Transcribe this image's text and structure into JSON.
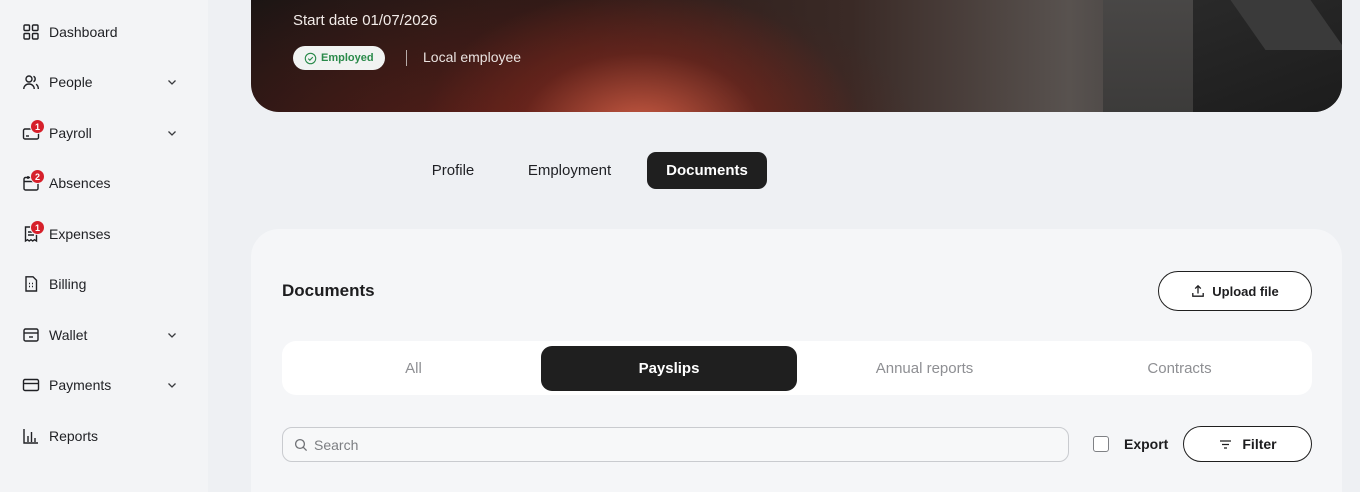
{
  "sidebar": {
    "items": [
      {
        "label": "Dashboard",
        "icon": "dashboard-grid-icon",
        "badge": null,
        "expandable": false
      },
      {
        "label": "People",
        "icon": "people-icon",
        "badge": null,
        "expandable": true
      },
      {
        "label": "Payroll",
        "icon": "payroll-icon",
        "badge": "1",
        "expandable": true
      },
      {
        "label": "Absences",
        "icon": "calendar-icon",
        "badge": "2",
        "expandable": false
      },
      {
        "label": "Expenses",
        "icon": "receipt-icon",
        "badge": "1",
        "expandable": false
      },
      {
        "label": "Billing",
        "icon": "invoice-icon",
        "badge": null,
        "expandable": false
      },
      {
        "label": "Wallet",
        "icon": "wallet-icon",
        "badge": null,
        "expandable": true
      },
      {
        "label": "Payments",
        "icon": "card-icon",
        "badge": null,
        "expandable": true
      },
      {
        "label": "Reports",
        "icon": "bar-chart-icon",
        "badge": null,
        "expandable": false
      }
    ]
  },
  "hero": {
    "start_date": "Start date 01/07/2026",
    "status": "Employed",
    "status_color": "#2a8a4a",
    "employee_type": "Local employee"
  },
  "tabs": [
    {
      "label": "Profile",
      "active": false
    },
    {
      "label": "Employment",
      "active": false
    },
    {
      "label": "Documents",
      "active": true
    }
  ],
  "documents": {
    "title": "Documents",
    "upload_label": "Upload file",
    "segments": [
      {
        "label": "All",
        "active": false
      },
      {
        "label": "Payslips",
        "active": true
      },
      {
        "label": "Annual reports",
        "active": false
      },
      {
        "label": "Contracts",
        "active": false
      }
    ],
    "search_placeholder": "Search",
    "export_label": "Export",
    "export_checked": false,
    "filter_label": "Filter"
  },
  "colors": {
    "accent_dark": "#1f1f1f",
    "badge": "#d6202b",
    "background": "#eef0f3"
  }
}
